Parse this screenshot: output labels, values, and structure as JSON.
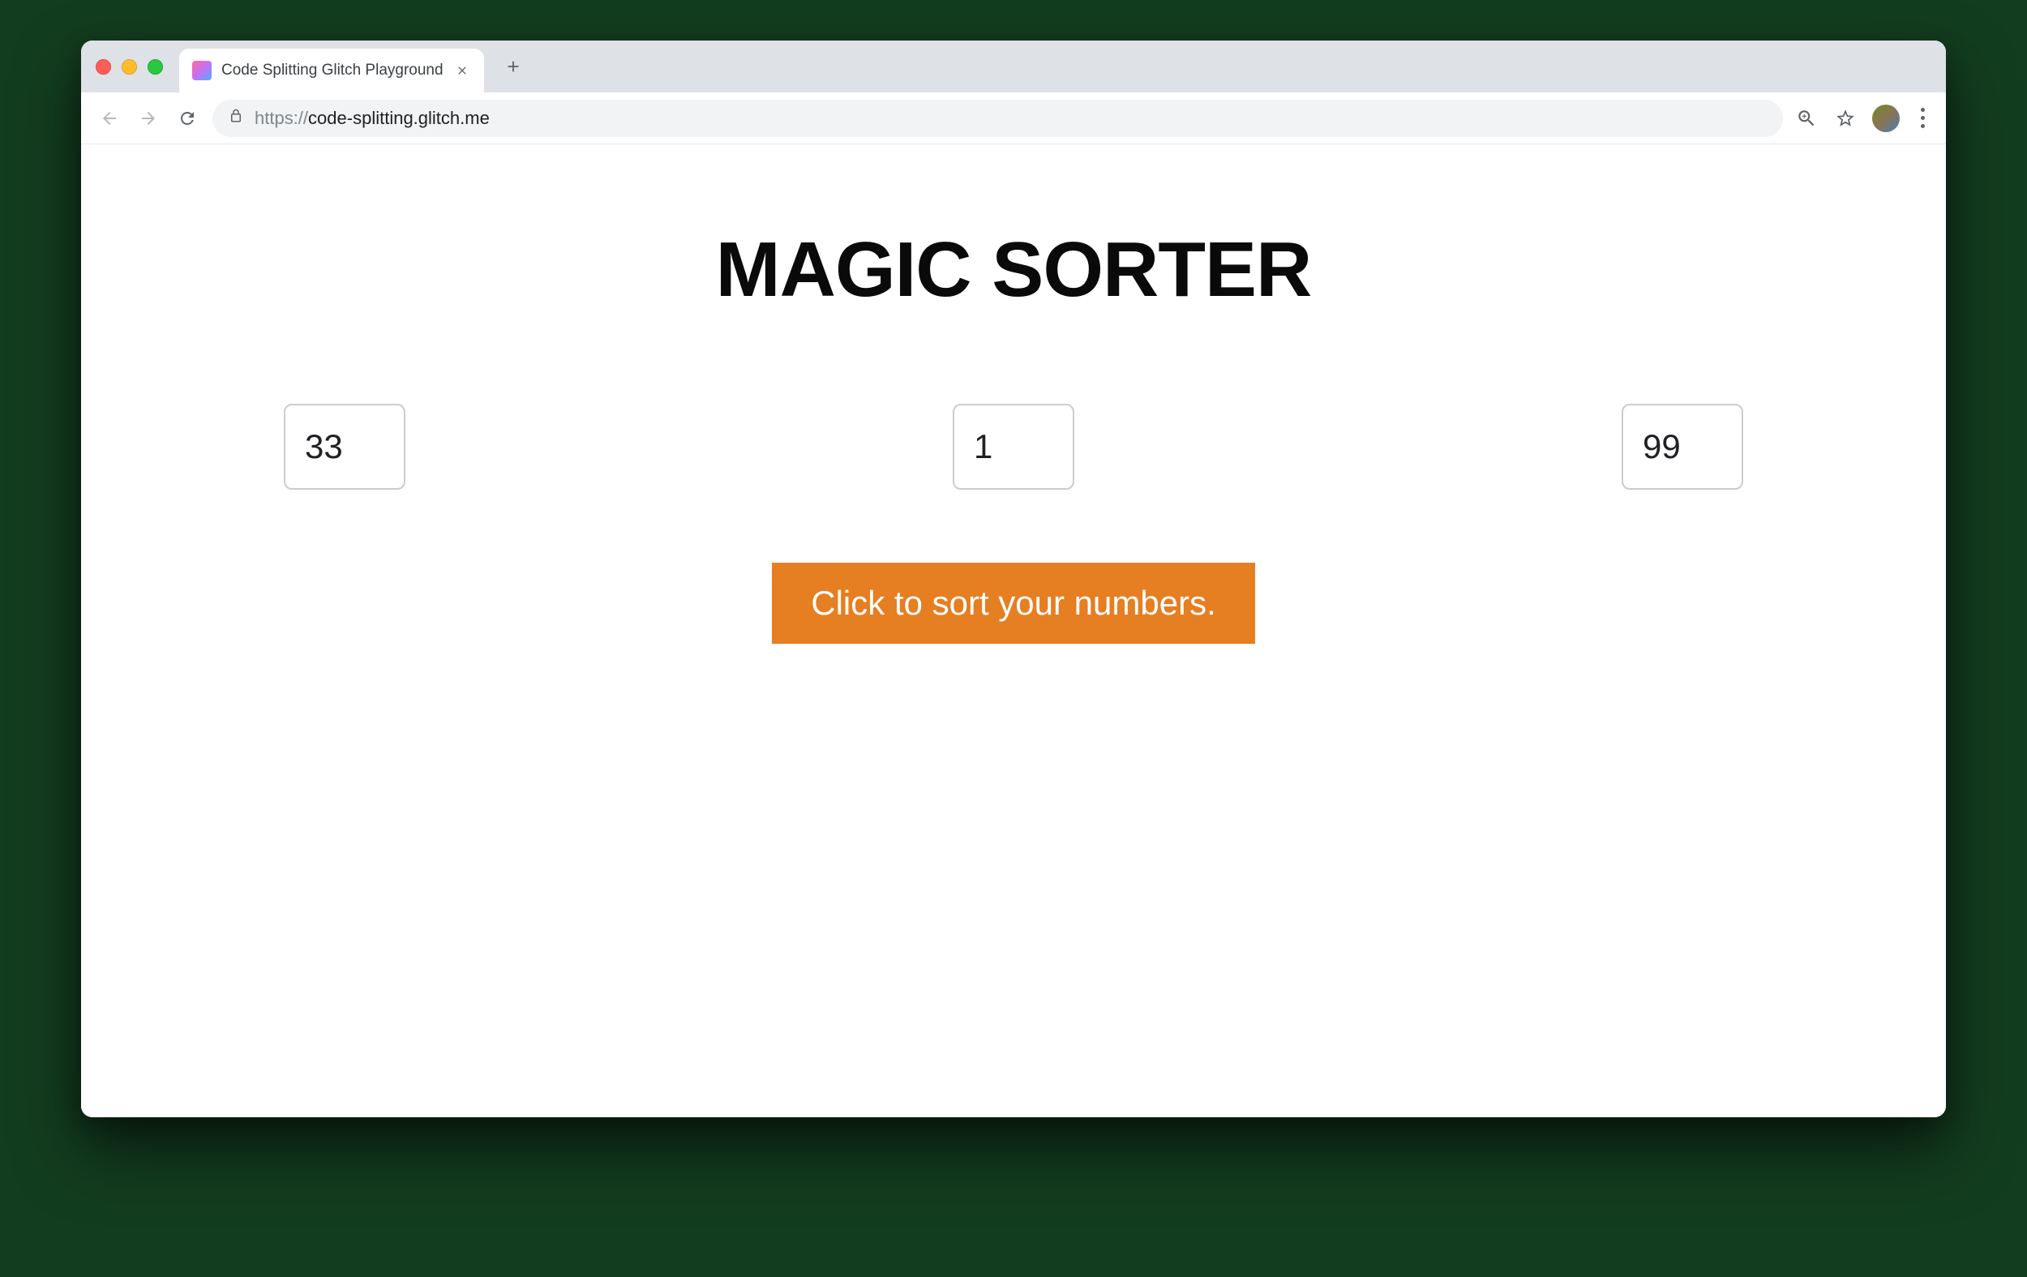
{
  "browser": {
    "tab": {
      "title": "Code Splitting Glitch Playground"
    },
    "url": {
      "protocol": "https://",
      "host": "code-splitting.glitch.me"
    }
  },
  "page": {
    "title": "MAGIC SORTER",
    "inputs": {
      "value1": "33",
      "value2": "1",
      "value3": "99"
    },
    "sort_button_label": "Click to sort your numbers."
  },
  "colors": {
    "button_bg": "#e67e22",
    "button_text": "#ffffff"
  }
}
